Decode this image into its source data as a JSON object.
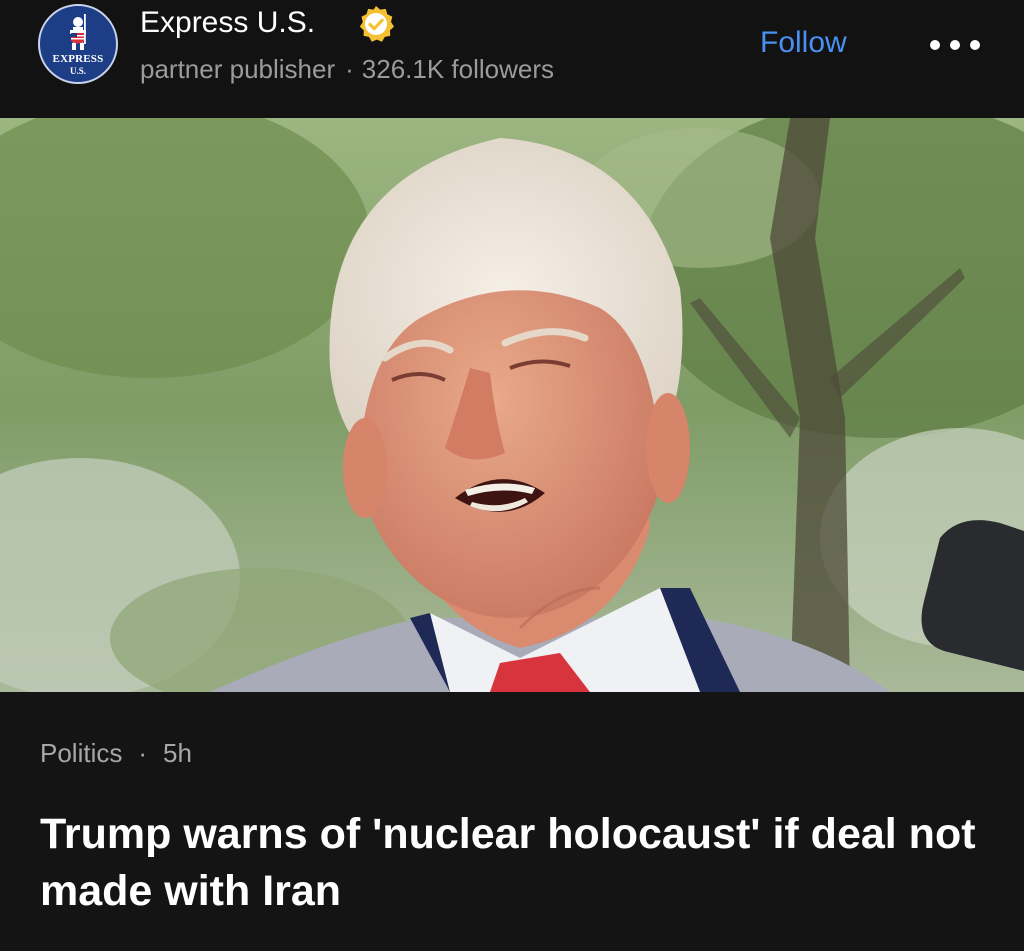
{
  "publisher": {
    "name": "Express U.S.",
    "logo_line1": "EXPRESS",
    "logo_line2": "U.S.",
    "type": "partner publisher",
    "separator": "·",
    "followers": "326.1K followers",
    "verified_icon": "verified-badge-icon"
  },
  "actions": {
    "follow_label": "Follow",
    "more_icon": "more-options-icon"
  },
  "article": {
    "image_icon": "news-photo",
    "category": "Politics",
    "separator": "·",
    "time": "5h",
    "headline": "Trump warns of 'nuclear holocaust' if deal not made with Iran"
  },
  "colors": {
    "background": "#141414",
    "accent": "#4a8ff2",
    "muted_text": "#9b9b9b",
    "verified": "#f3c133"
  }
}
